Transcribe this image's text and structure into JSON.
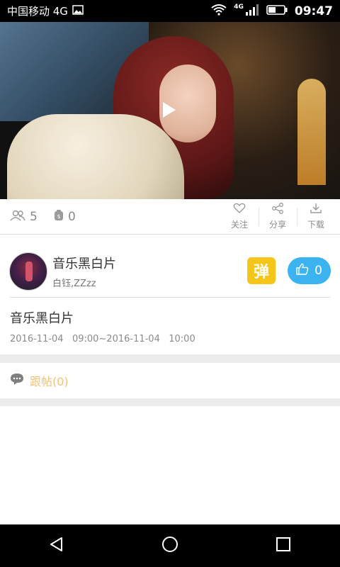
{
  "status_bar": {
    "carrier": "中国移动 4G",
    "network": "4G",
    "time": "09:47",
    "icons": [
      "image-icon",
      "wifi-icon",
      "signal-icon",
      "battery-icon"
    ]
  },
  "video": {
    "play_icon": "play-icon"
  },
  "stats": {
    "users_count": "5",
    "coins_count": "0",
    "actions": [
      {
        "label": "关注",
        "icon": "heart-icon"
      },
      {
        "label": "分享",
        "icon": "share-icon"
      },
      {
        "label": "下载",
        "icon": "download-icon"
      }
    ]
  },
  "channel": {
    "title": "音乐黑白片",
    "subtitle": "白钰,ZZzz",
    "danmu_label": "弹",
    "like_count": "0",
    "colors": {
      "danmu_bg": "#f6c51a",
      "like_bg": "#3bb3f0"
    }
  },
  "content": {
    "title": "音乐黑白片",
    "date_range": "2016-11-04   09:00~2016-11-04   10:00"
  },
  "replies": {
    "label": "跟帖(0)",
    "color": "#f2c27a"
  },
  "nav": {
    "back_icon": "back-icon",
    "home_icon": "home-icon",
    "recent_icon": "recent-apps-icon"
  }
}
